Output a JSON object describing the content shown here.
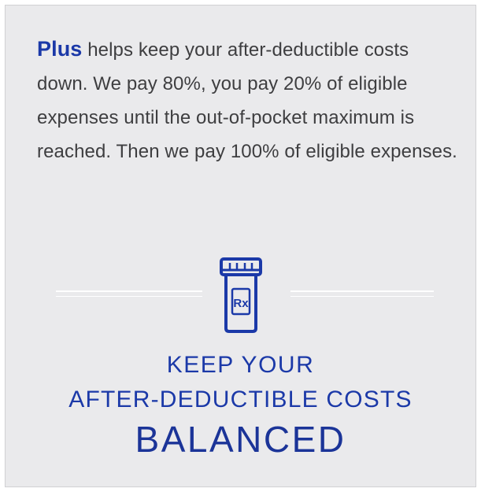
{
  "description": {
    "brand": "Plus",
    "text": " helps keep your after-deductible costs down. We pay 80%, you pay 20% of eligible expenses until the out-of-pocket maximum is reached. Then we pay 100% of eligible expenses."
  },
  "icon": {
    "name": "rx-pill-bottle-icon",
    "glyph": "Rx"
  },
  "tagline": {
    "line1": "KEEP YOUR",
    "line2": "AFTER-DEDUCTIBLE COSTS",
    "line3": "BALANCED"
  },
  "colors": {
    "brand_blue": "#1b39a8",
    "body_text": "#3e3e40",
    "panel_bg": "#eaeaec"
  }
}
